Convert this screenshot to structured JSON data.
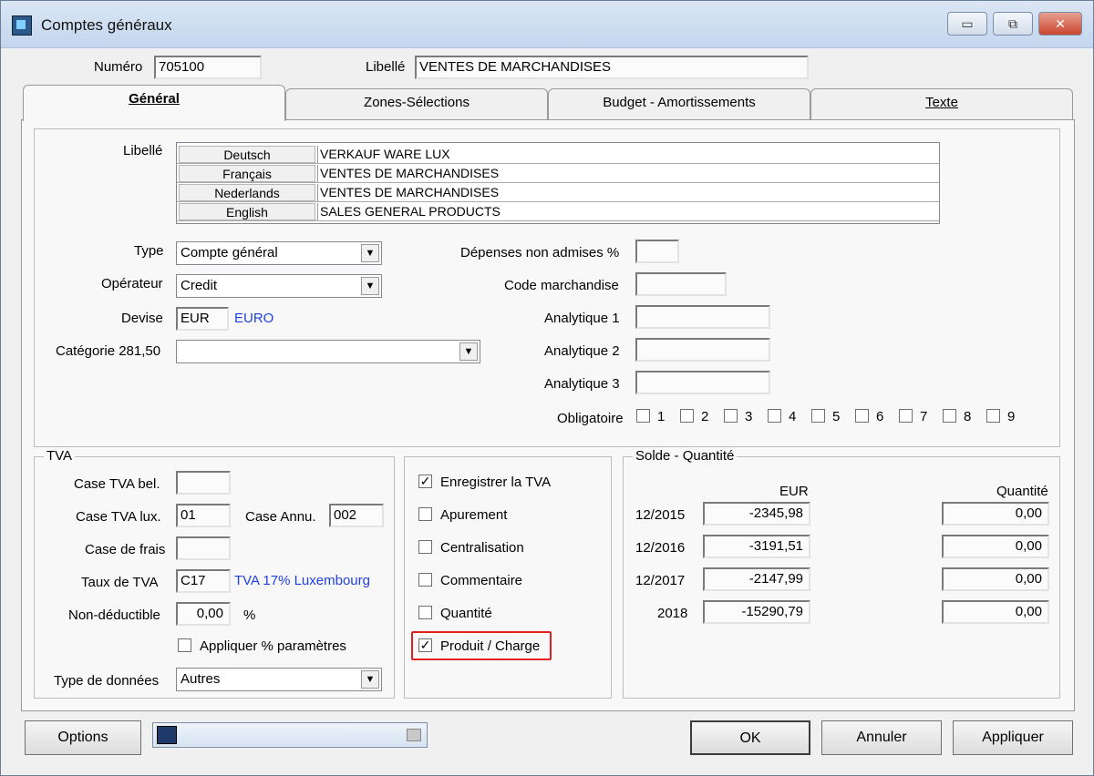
{
  "window": {
    "title": "Comptes généraux",
    "minimize": "▭",
    "restore": "⧉",
    "close": "✕"
  },
  "header": {
    "numero_label": "Numéro",
    "numero_value": "705100",
    "libelle_label": "Libellé",
    "libelle_value": "VENTES DE MARCHANDISES"
  },
  "tabs": [
    "Général",
    "Zones-Sélections",
    "Budget - Amortissements",
    "Texte"
  ],
  "general": {
    "libelle_label": "Libellé",
    "languages": [
      {
        "lang": "Deutsch",
        "value": "VERKAUF WARE LUX"
      },
      {
        "lang": "Français",
        "value": "VENTES DE MARCHANDISES"
      },
      {
        "lang": "Nederlands",
        "value": "VENTES DE MARCHANDISES"
      },
      {
        "lang": "English",
        "value": "SALES GENERAL PRODUCTS"
      }
    ],
    "type_label": "Type",
    "type_value": "Compte général",
    "operateur_label": "Opérateur",
    "operateur_value": "Credit",
    "devise_label": "Devise",
    "devise_code": "EUR",
    "devise_name": "EURO",
    "categorie_label": "Catégorie 281,50",
    "categorie_value": "",
    "depenses_label": "Dépenses non admises %",
    "depenses_value": "",
    "code_label": "Code marchandise",
    "code_value": "",
    "analytique1_label": "Analytique 1",
    "analytique2_label": "Analytique 2",
    "analytique3_label": "Analytique 3",
    "obligatoire_label": "Obligatoire",
    "obligatoire_items": [
      "1",
      "2",
      "3",
      "4",
      "5",
      "6",
      "7",
      "8",
      "9"
    ]
  },
  "tva": {
    "title": "TVA",
    "case_bel_label": "Case TVA bel.",
    "case_bel_value": "",
    "case_lux_label": "Case TVA lux.",
    "case_lux_value": "01",
    "case_annu_label": "Case Annu.",
    "case_annu_value": "002",
    "frais_label": "Case de frais",
    "frais_value": "",
    "taux_label": "Taux de TVA",
    "taux_code": "C17",
    "taux_desc": "TVA 17% Luxembourg",
    "nondeduct_label": "Non-déductible",
    "nondeduct_value": "0,00",
    "nondeduct_unit": "%",
    "appliquer_label": "Appliquer % paramètres",
    "type_donnees_label": "Type de données",
    "type_donnees_value": "Autres"
  },
  "options": {
    "items": [
      {
        "label": "Enregistrer la TVA",
        "checked": true
      },
      {
        "label": "Apurement",
        "checked": false
      },
      {
        "label": "Centralisation",
        "checked": false
      },
      {
        "label": "Commentaire",
        "checked": false
      },
      {
        "label": "Quantité",
        "checked": false
      },
      {
        "label": "Produit / Charge",
        "checked": true
      }
    ]
  },
  "solde": {
    "title": "Solde - Quantité",
    "col_eur": "EUR",
    "col_qty": "Quantité",
    "rows": [
      {
        "period": "12/2015",
        "eur": "-2345,98",
        "qty": "0,00"
      },
      {
        "period": "12/2016",
        "eur": "-3191,51",
        "qty": "0,00"
      },
      {
        "period": "12/2017",
        "eur": "-2147,99",
        "qty": "0,00"
      },
      {
        "period": "2018",
        "eur": "-15290,79",
        "qty": "0,00"
      }
    ]
  },
  "footer": {
    "options_label": "Options",
    "ok_label": "OK",
    "annuler_label": "Annuler",
    "appliquer_label": "Appliquer"
  },
  "colors": {
    "highlight": "#e02020",
    "link_blue": "#1f3fe0"
  }
}
